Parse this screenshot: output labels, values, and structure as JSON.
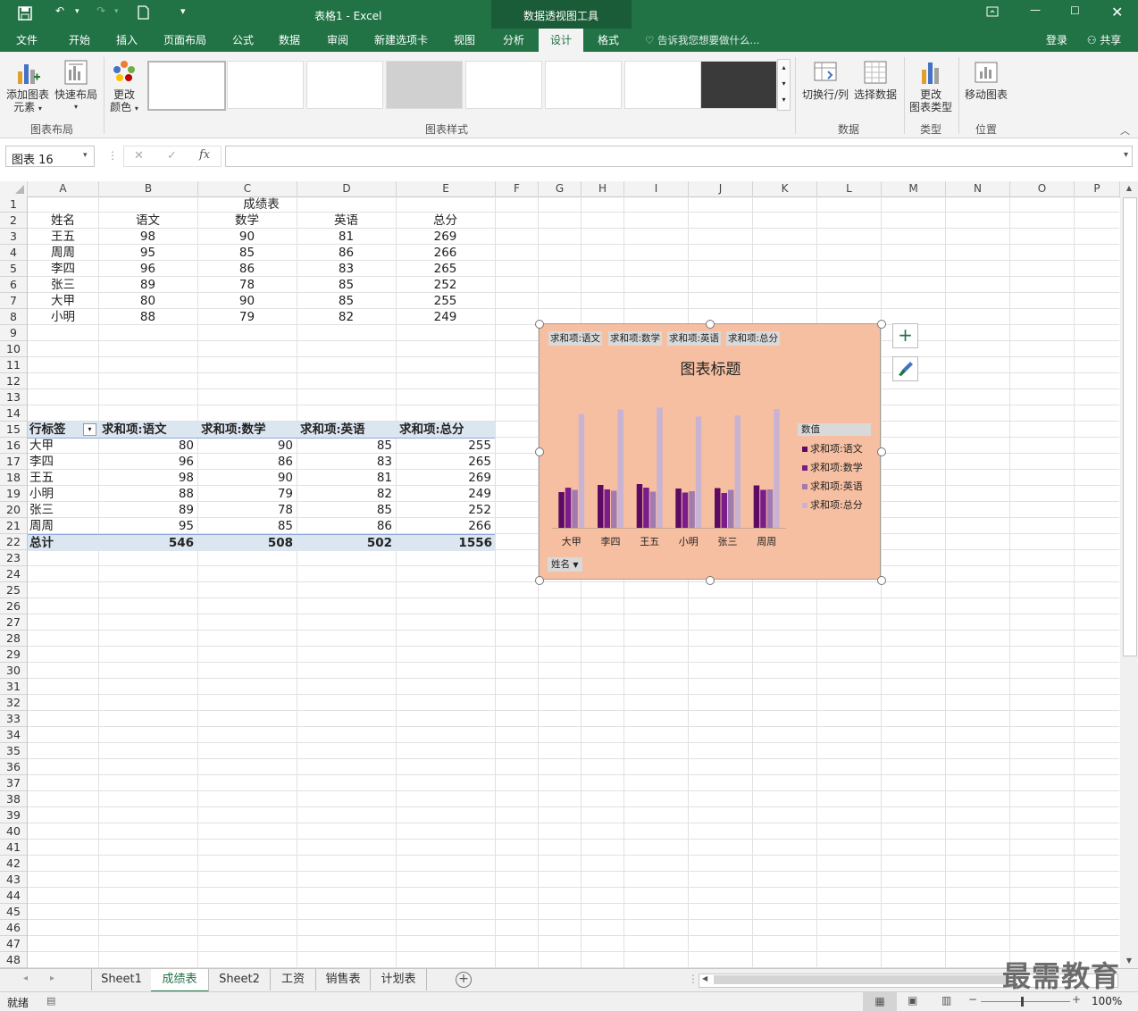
{
  "window": {
    "title": "表格1 - Excel",
    "context_tab_group": "数据透视图工具"
  },
  "tabs": [
    "文件",
    "开始",
    "插入",
    "页面布局",
    "公式",
    "数据",
    "审阅",
    "新建选项卡",
    "视图",
    "分析",
    "设计",
    "格式"
  ],
  "active_tab": "设计",
  "tell_me": "告诉我您想要做什么...",
  "account": {
    "login": "登录",
    "share": "共享"
  },
  "ribbon": {
    "add_element": "添加图表元素",
    "add_element_l1": "添加图表",
    "add_element_l2": "元素",
    "quick_layout": "快速布局",
    "change_color_l1": "更改",
    "change_color_l2": "颜色",
    "group_layout": "图表布局",
    "group_styles": "图表样式",
    "switch_row_col": "切换行/列",
    "select_data": "选择数据",
    "group_data": "数据",
    "change_type_l1": "更改",
    "change_type_l2": "图表类型",
    "group_type": "类型",
    "move_chart": "移动图表",
    "group_location": "位置"
  },
  "formula_bar": {
    "name_box": "图表 16",
    "cancel": "✕",
    "enter": "✓",
    "fx": "fx",
    "formula": ""
  },
  "columns": [
    "A",
    "B",
    "C",
    "D",
    "E",
    "F",
    "G",
    "H",
    "I",
    "J",
    "K",
    "L",
    "M",
    "N",
    "O",
    "P"
  ],
  "row_count": 48,
  "table": {
    "title": "成绩表",
    "headers": [
      "姓名",
      "语文",
      "数学",
      "英语",
      "总分"
    ],
    "rows": [
      [
        "王五",
        "98",
        "90",
        "81",
        "269"
      ],
      [
        "周周",
        "95",
        "85",
        "86",
        "266"
      ],
      [
        "李四",
        "96",
        "86",
        "83",
        "265"
      ],
      [
        "张三",
        "89",
        "78",
        "85",
        "252"
      ],
      [
        "大甲",
        "80",
        "90",
        "85",
        "255"
      ],
      [
        "小明",
        "88",
        "79",
        "82",
        "249"
      ]
    ]
  },
  "pivot": {
    "headers": [
      "行标签",
      "求和项:语文",
      "求和项:数学",
      "求和项:英语",
      "求和项:总分"
    ],
    "rows": [
      [
        "大甲",
        "80",
        "90",
        "85",
        "255"
      ],
      [
        "李四",
        "96",
        "86",
        "83",
        "265"
      ],
      [
        "王五",
        "98",
        "90",
        "81",
        "269"
      ],
      [
        "小明",
        "88",
        "79",
        "82",
        "249"
      ],
      [
        "张三",
        "89",
        "78",
        "85",
        "252"
      ],
      [
        "周周",
        "95",
        "85",
        "86",
        "266"
      ]
    ],
    "total": [
      "总计",
      "546",
      "508",
      "502",
      "1556"
    ]
  },
  "chart_data": {
    "type": "bar",
    "title": "图表标题",
    "categories": [
      "大甲",
      "李四",
      "王五",
      "小明",
      "张三",
      "周周"
    ],
    "series": [
      {
        "name": "求和项:语文",
        "values": [
          80,
          96,
          98,
          88,
          89,
          95
        ],
        "color": "#5c0a63"
      },
      {
        "name": "求和项:数学",
        "values": [
          90,
          86,
          90,
          79,
          78,
          85
        ],
        "color": "#7a1c8a"
      },
      {
        "name": "求和项:英语",
        "values": [
          85,
          83,
          81,
          82,
          85,
          86
        ],
        "color": "#a07ab0"
      },
      {
        "name": "求和项:总分",
        "values": [
          255,
          265,
          269,
          249,
          252,
          266
        ],
        "color": "#c9b3d3"
      }
    ],
    "legend_title": "数值",
    "legend_position": "right",
    "axis_field_button": "姓名",
    "ylim": [
      0,
      280
    ],
    "grid": false,
    "background": "#f7bfa1"
  },
  "sheets": [
    "Sheet1",
    "成绩表",
    "Sheet2",
    "工资",
    "销售表",
    "计划表"
  ],
  "active_sheet": "成绩表",
  "status": {
    "ready": "就绪",
    "zoom": "100%"
  },
  "watermark": "最需教育",
  "colors": {
    "excel_green": "#217346"
  }
}
